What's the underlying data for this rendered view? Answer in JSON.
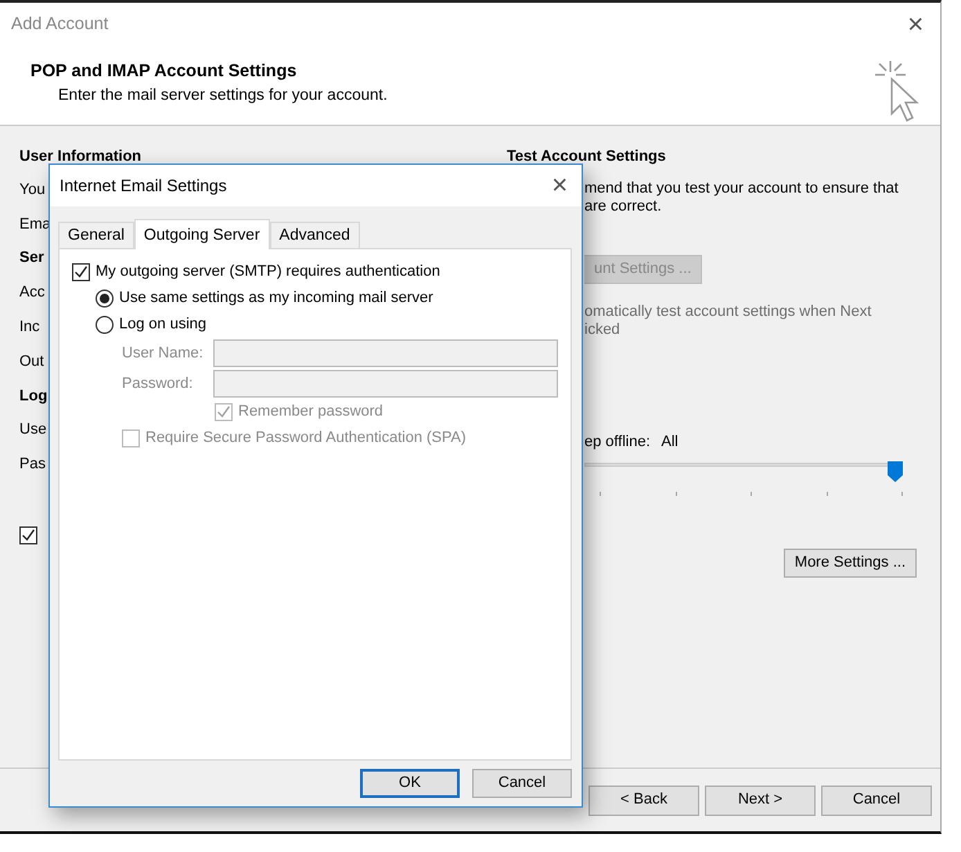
{
  "window": {
    "title": "Add Account",
    "close": "×"
  },
  "header": {
    "title": "POP and IMAP Account Settings",
    "subtitle": "Enter the mail server settings for your account."
  },
  "left_column": {
    "heading": "User Information",
    "rows": [
      {
        "kind": "label",
        "text": "You"
      },
      {
        "kind": "label",
        "text": "Ema"
      },
      {
        "kind": "heading",
        "text": "Ser"
      },
      {
        "kind": "label",
        "text": "Acc"
      },
      {
        "kind": "label",
        "text": "Inc"
      },
      {
        "kind": "label",
        "text": "Out"
      },
      {
        "kind": "heading",
        "text": "Log"
      },
      {
        "kind": "label",
        "text": "Use"
      },
      {
        "kind": "label",
        "text": "Pas"
      },
      {
        "kind": "checkbox",
        "checked": true
      }
    ]
  },
  "right_column": {
    "heading": "Test Account Settings",
    "description": [
      "mend that you test your account to ensure that",
      "are correct."
    ],
    "test_button": {
      "label": "unt Settings ...",
      "disabled": true
    },
    "auto_test": {
      "lines": [
        "omatically test account settings when Next",
        "icked"
      ],
      "disabled": true
    },
    "offline": {
      "label": "ep offline:",
      "value": "All",
      "level": 1
    },
    "more_settings_button": "More Settings ..."
  },
  "footer_buttons": [
    {
      "label": "< Back"
    },
    {
      "label": "Next >"
    },
    {
      "label": "Cancel"
    }
  ],
  "dialog": {
    "title": "Internet Email Settings",
    "close": "×",
    "tabs": [
      {
        "label": "General",
        "selected": false
      },
      {
        "label": "Outgoing Server",
        "selected": true
      },
      {
        "label": "Advanced",
        "selected": false
      }
    ],
    "options": [
      {
        "kind": "checkbox",
        "label": "My outgoing server (SMTP) requires authentication",
        "checked": true,
        "disabled": false
      },
      {
        "kind": "radio",
        "label": "Use same settings as my incoming mail server",
        "selected": true
      },
      {
        "kind": "radio",
        "label": "Log on using",
        "selected": false
      },
      {
        "kind": "field",
        "label": "User Name:",
        "disabled": true
      },
      {
        "kind": "field",
        "label": "Password:",
        "disabled": true
      },
      {
        "kind": "field-checkbox",
        "label": "Remember password",
        "checked": true,
        "disabled": true
      },
      {
        "kind": "sub-checkbox",
        "label": "Require Secure Password Authentication (SPA)",
        "checked": false,
        "disabled": true
      }
    ],
    "buttons": [
      {
        "label": "OK",
        "default": true
      },
      {
        "label": "Cancel",
        "default": false
      }
    ]
  }
}
